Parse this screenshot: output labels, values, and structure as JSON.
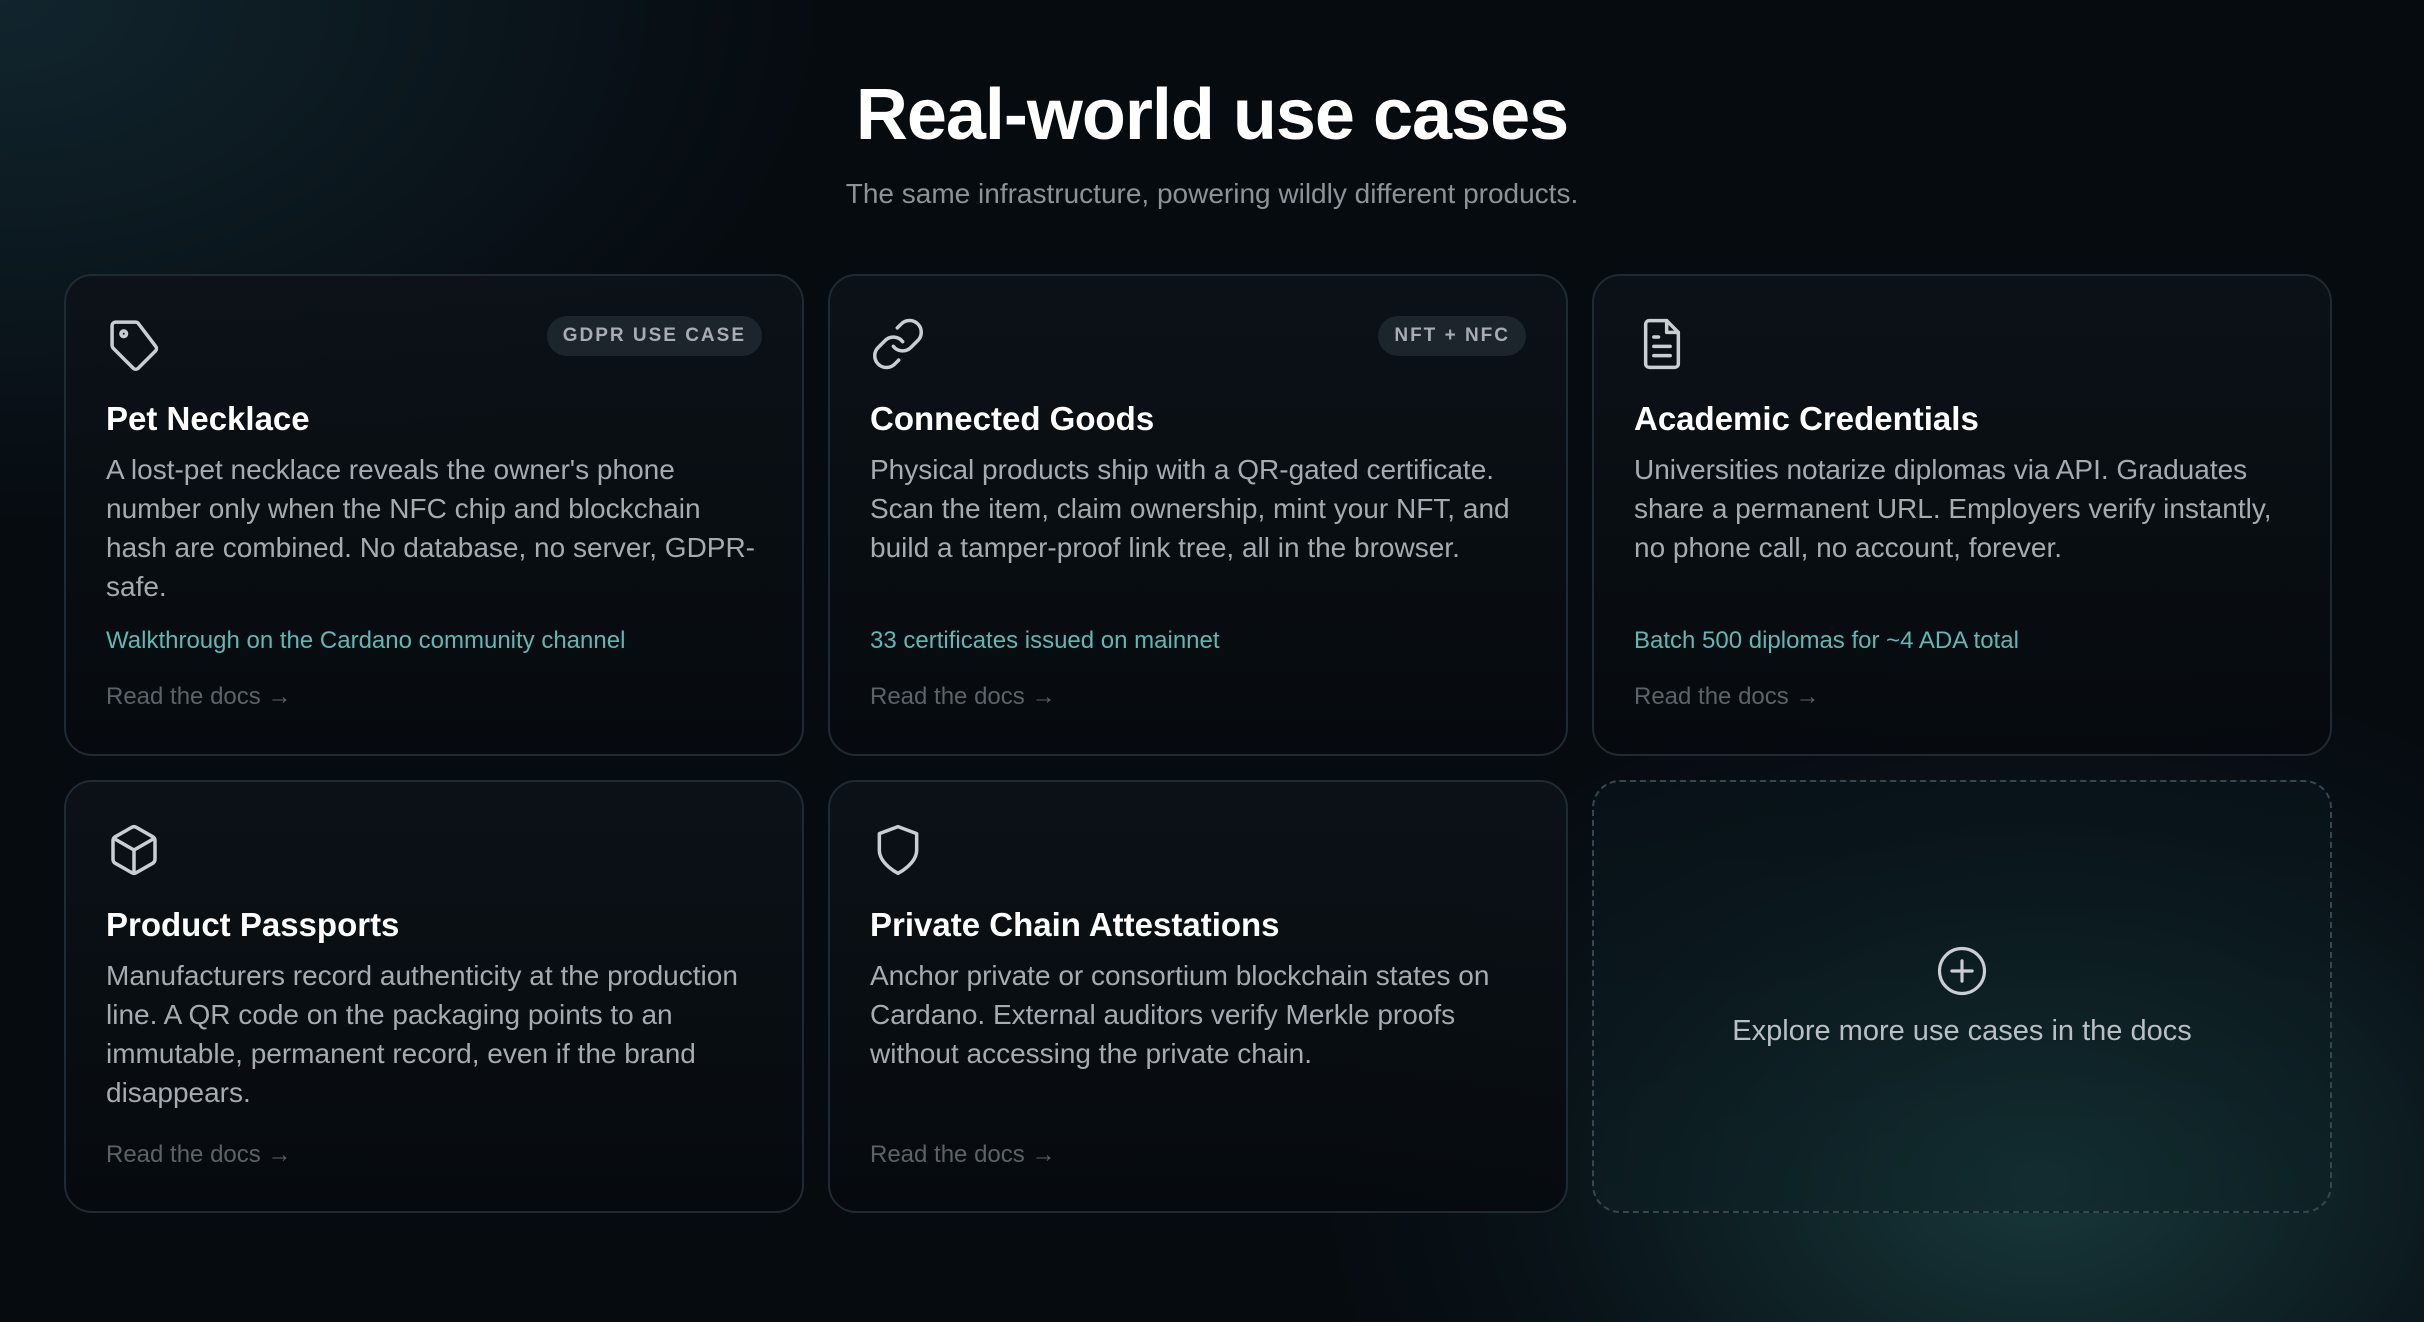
{
  "header": {
    "title": "Real-world use cases",
    "subtitle": "The same infrastructure, powering wildly different products."
  },
  "colors": {
    "accent": "#5fb8b4",
    "muted_link": "#5b6268",
    "background": "#060b10"
  },
  "cards": [
    {
      "icon": "tag-icon",
      "badge": "GDPR USE CASE",
      "title": "Pet Necklace",
      "description": "A lost-pet necklace reveals the owner's phone number only when the NFC chip and blockchain hash are combined. No database, no server, GDPR-safe.",
      "highlight": "Walkthrough on the Cardano community channel",
      "link": "Read the docs →"
    },
    {
      "icon": "link-icon",
      "badge": "NFT + NFC",
      "title": "Connected Goods",
      "description": "Physical products ship with a QR-gated certificate. Scan the item, claim ownership, mint your NFT, and build a tamper-proof link tree, all in the browser.",
      "highlight": "33 certificates issued on mainnet",
      "link": "Read the docs →"
    },
    {
      "icon": "document-icon",
      "title": "Academic Credentials",
      "description": "Universities notarize diplomas via API. Graduates share a permanent URL. Employers verify instantly, no phone call, no account, forever.",
      "highlight": "Batch 500 diplomas for ~4 ADA total",
      "link": "Read the docs →"
    },
    {
      "icon": "box-icon",
      "title": "Product Passports",
      "description": "Manufacturers record authenticity at the production line. A QR code on the packaging points to an immutable, permanent record, even if the brand disappears.",
      "link": "Read the docs →"
    },
    {
      "icon": "shield-icon",
      "title": "Private Chain Attestations",
      "description": "Anchor private or consortium blockchain states on Cardano. External auditors verify Merkle proofs without accessing the private chain.",
      "link": "Read the docs →"
    }
  ],
  "explore": {
    "icon": "plus-circle-icon",
    "label": "Explore more use cases in the docs"
  }
}
